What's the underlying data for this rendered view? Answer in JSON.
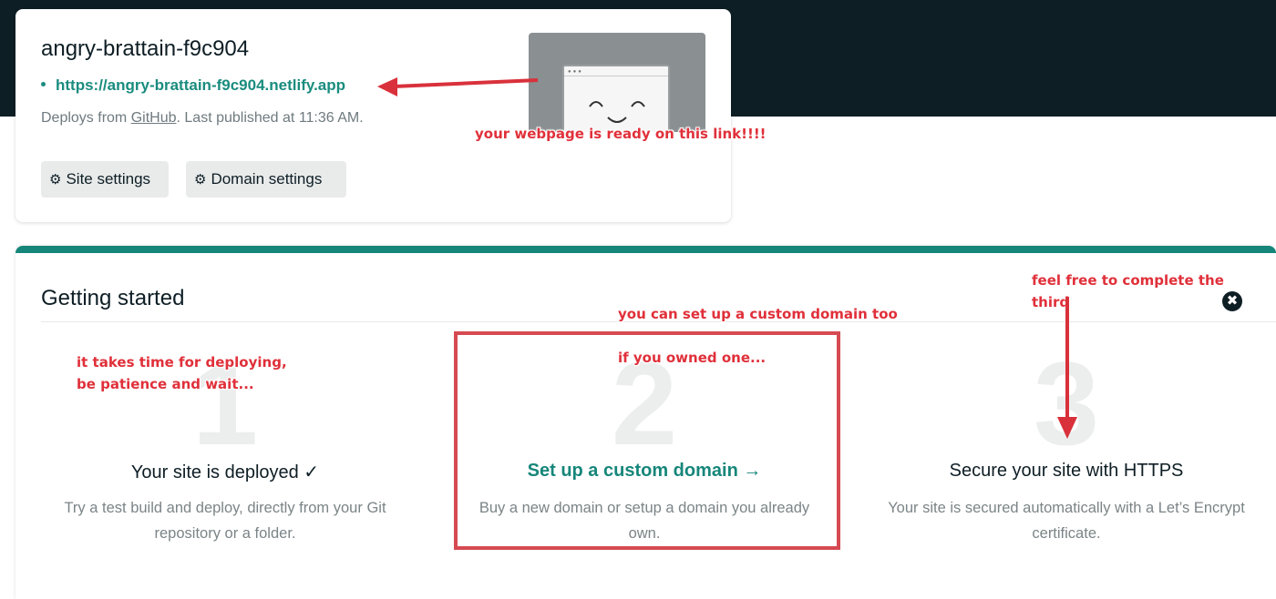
{
  "site": {
    "name": "angry-brattain-f9c904",
    "url": "https://angry-brattain-f9c904.netlify.app",
    "deploy_prefix": "Deploys from ",
    "deploy_source": "GitHub",
    "deploy_suffix": ". Last published at 11:36 AM.",
    "buttons": {
      "site_settings": "Site settings",
      "domain_settings": "Domain settings"
    }
  },
  "getting_started": {
    "title": "Getting started",
    "close_symbol": "✖",
    "steps": [
      {
        "number": "1",
        "title": "Your site is deployed ✓",
        "description": "Try a test build and deploy, directly from your Git repository or a folder."
      },
      {
        "number": "2",
        "title": "Set up a custom domain →",
        "description": "Buy a new domain or setup a domain you already own."
      },
      {
        "number": "3",
        "title": "Secure your site with HTTPS",
        "description": "Your site is secured automatically with a Let’s Encrypt certificate."
      }
    ]
  },
  "annotations": {
    "link_ready": "your webpage is ready on this link!!!!",
    "deploy_line1": "it takes time for deploying,",
    "deploy_line2": "be patience and wait...",
    "domain_line1": "you can set up a custom domain too",
    "domain_line2": "if you owned one...",
    "third_line1": "feel free to complete the",
    "third_line2": "third"
  },
  "colors": {
    "accent": "#16867a",
    "link": "#1a8c7e",
    "annotation": "#e0303a",
    "dark": "#0e1e25"
  },
  "icons": [
    "gear-icon",
    "close-icon",
    "browser-preview-icon"
  ]
}
